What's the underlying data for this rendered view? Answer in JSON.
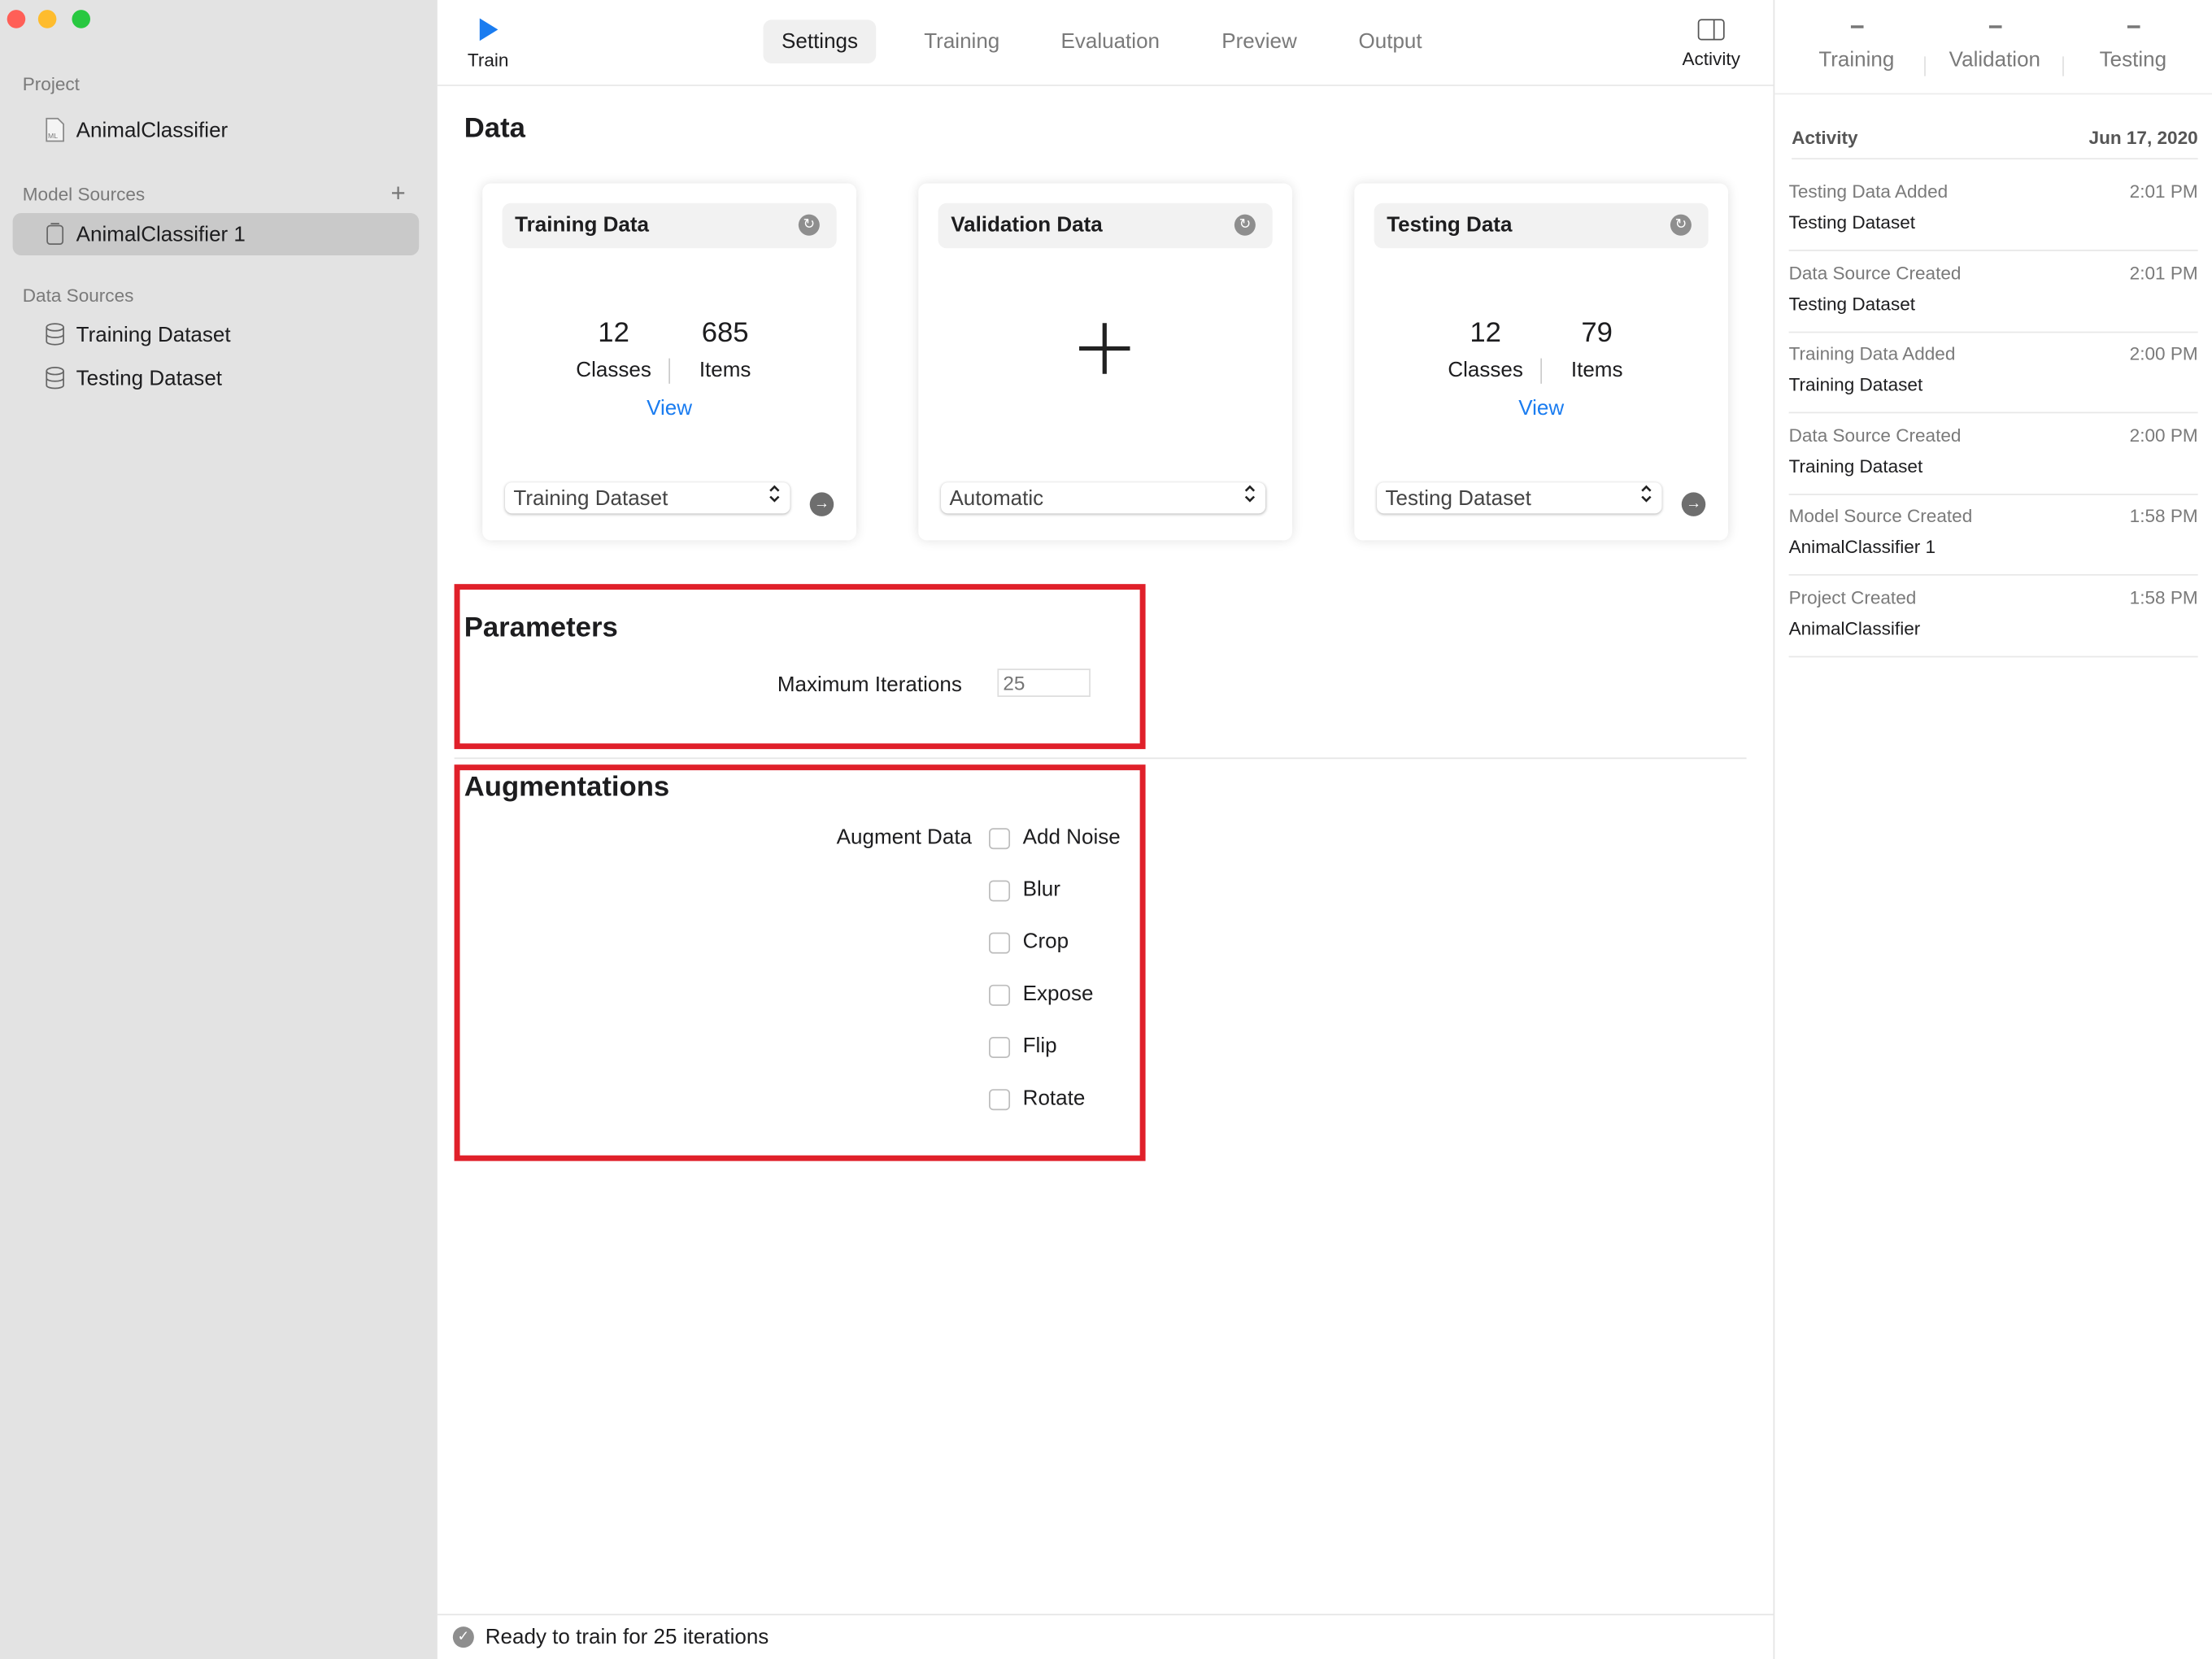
{
  "window": {
    "controls": {
      "close": "#ff5f57",
      "minimize": "#febc2e",
      "zoom": "#28c840"
    }
  },
  "sidebar": {
    "project_header": "Project",
    "project": "AnimalClassifier",
    "model_sources_header": "Model Sources",
    "model_sources": [
      "AnimalClassifier 1"
    ],
    "data_sources_header": "Data Sources",
    "data_sources": [
      "Training Dataset",
      "Testing Dataset"
    ]
  },
  "toolbar": {
    "train_label": "Train",
    "activity_label": "Activity",
    "tabs": [
      "Settings",
      "Training",
      "Evaluation",
      "Preview",
      "Output"
    ],
    "active_tab": "Settings",
    "accent": "#1a7cf0"
  },
  "data_section": {
    "title": "Data",
    "cards": [
      {
        "title": "Training Data",
        "classes": "12",
        "classes_label": "Classes",
        "items": "685",
        "items_label": "Items",
        "view": "View",
        "source": "Training Dataset"
      },
      {
        "title": "Validation Data",
        "source": "Automatic"
      },
      {
        "title": "Testing Data",
        "classes": "12",
        "classes_label": "Classes",
        "items": "79",
        "items_label": "Items",
        "view": "View",
        "source": "Testing Dataset"
      }
    ]
  },
  "parameters": {
    "title": "Parameters",
    "max_iterations_label": "Maximum Iterations",
    "max_iterations_placeholder": "25"
  },
  "augmentations": {
    "title": "Augmentations",
    "label": "Augment Data",
    "options": [
      {
        "label": "Add Noise",
        "checked": false
      },
      {
        "label": "Blur",
        "checked": false
      },
      {
        "label": "Crop",
        "checked": false
      },
      {
        "label": "Expose",
        "checked": false
      },
      {
        "label": "Flip",
        "checked": false
      },
      {
        "label": "Rotate",
        "checked": false
      }
    ]
  },
  "status": {
    "text": "Ready to train for 25 iterations"
  },
  "right_panel": {
    "metrics": [
      {
        "label": "Training",
        "value": "–"
      },
      {
        "label": "Validation",
        "value": "–"
      },
      {
        "label": "Testing",
        "value": "–"
      }
    ],
    "activity_header": "Activity",
    "date": "Jun 17, 2020",
    "activity": [
      {
        "event": "Testing Data Added",
        "time": "2:01 PM",
        "target": "Testing Dataset"
      },
      {
        "event": "Data Source Created",
        "time": "2:01 PM",
        "target": "Testing Dataset"
      },
      {
        "event": "Training Data Added",
        "time": "2:00 PM",
        "target": "Training Dataset"
      },
      {
        "event": "Data Source Created",
        "time": "2:00 PM",
        "target": "Training Dataset"
      },
      {
        "event": "Model Source Created",
        "time": "1:58 PM",
        "target": "AnimalClassifier 1"
      },
      {
        "event": "Project Created",
        "time": "1:58 PM",
        "target": "AnimalClassifier"
      }
    ]
  }
}
